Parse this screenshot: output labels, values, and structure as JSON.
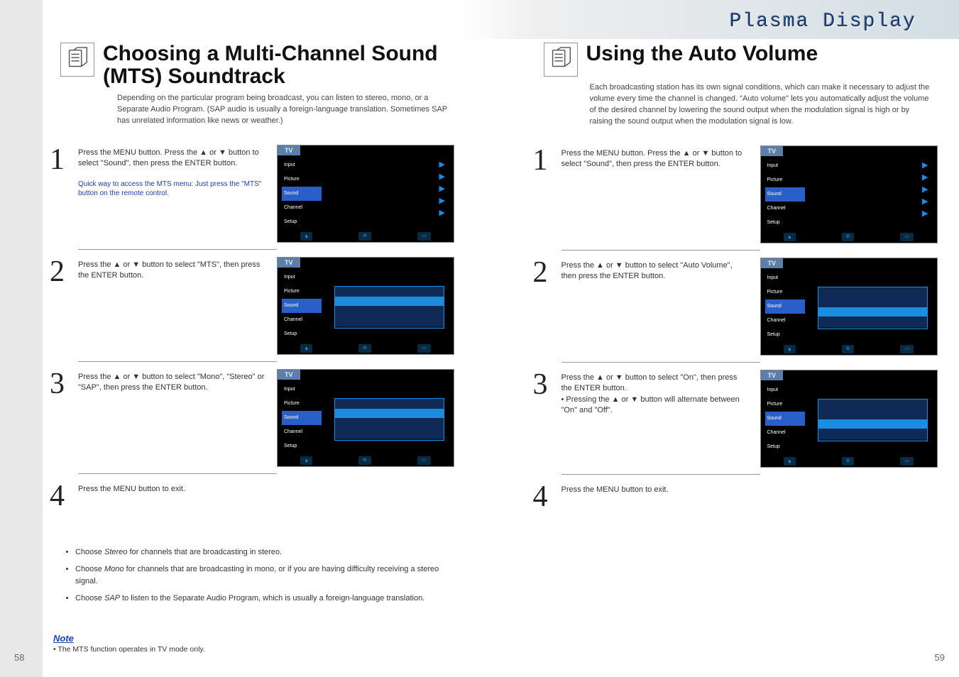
{
  "plasma_header": "Plasma Display",
  "left": {
    "title": "Choosing a Multi-Channel Sound (MTS) Soundtrack",
    "intro": "Depending on the particular program being broadcast, you can listen to stereo, mono, or a Separate Audio Program. (SAP audio is usually a foreign-language translation. Sometimes SAP has unrelated information like news or weather.)",
    "steps": [
      {
        "num": "1",
        "text": "Press the MENU button. Press the ▲ or ▼ button to select \"Sound\", then press the ENTER button.",
        "tip": "Quick way to access the MTS menu: Just press the \"MTS\" button on the remote control."
      },
      {
        "num": "2",
        "text": "Press the ▲ or ▼ button to select \"MTS\", then press the ENTER button."
      },
      {
        "num": "3",
        "text": "Press the ▲ or ▼ button to select \"Mono\", \"Stereo\" or \"SAP\", then press the ENTER button."
      },
      {
        "num": "4",
        "text": "Press the MENU button to exit."
      }
    ],
    "bullets": [
      {
        "pre": "Choose ",
        "em": "Stereo",
        "post": " for channels that are broadcasting in stereo."
      },
      {
        "pre": "Choose ",
        "em": "Mono",
        "post": " for channels that are broadcasting in mono, or if you are having difficulty receiving a stereo signal."
      },
      {
        "pre": "Choose ",
        "em": "SAP",
        "post": " to listen to the Separate Audio Program, which is usually a foreign-language translation."
      }
    ],
    "note_label": "Note",
    "note_text": "• The MTS function operates in TV mode only.",
    "page_num": "58"
  },
  "right": {
    "title": "Using the Auto Volume",
    "intro": "Each broadcasting station has its own signal conditions, which can make it necessary to adjust the volume every time the channel is changed. \"Auto volume\" lets you automatically adjust the volume of the desired channel by lowering the sound output when the modulation signal is high or by raising the sound output when the modulation signal is low.",
    "steps": [
      {
        "num": "1",
        "text": "Press the MENU button. Press the ▲ or ▼ button to select \"Sound\", then press the ENTER button."
      },
      {
        "num": "2",
        "text": "Press the ▲ or ▼ button to select \"Auto Volume\", then press the ENTER button."
      },
      {
        "num": "3",
        "text": "Press the ▲ or ▼ button to select \"On\", then press the ENTER button.",
        "extra": "• Pressing the ▲ or ▼ button will alternate between \"On\" and \"Off\"."
      },
      {
        "num": "4",
        "text": "Press the MENU button to exit."
      }
    ],
    "page_num": "59"
  },
  "tv": {
    "label": "TV",
    "menu": [
      "Input",
      "Picture",
      "Sound",
      "Channel",
      "Setup"
    ]
  }
}
